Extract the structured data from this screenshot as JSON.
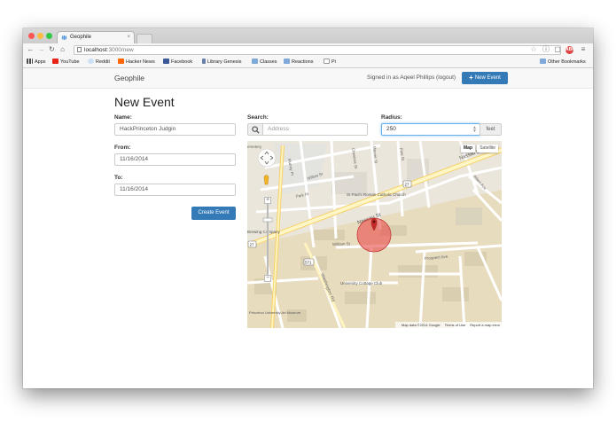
{
  "browser": {
    "tab_title": "Geophile",
    "tab_close": "×",
    "url_host": "localhost",
    "url_path": ":3000/new",
    "bookmarks": [
      "Apps",
      "YouTube",
      "Reddit",
      "Hacker News",
      "Facebook",
      "Library Genesis",
      "Classes",
      "Reactions",
      "Pi"
    ],
    "other_bookmarks": "Other Bookmarks",
    "abp_label": "ABP"
  },
  "nav": {
    "brand": "Geophile",
    "signed_in": "Signed in as Aqeel Phillips (logout)",
    "new_event_plus": "+",
    "new_event_label": "New Event"
  },
  "form": {
    "heading": "New Event",
    "name_label": "Name:",
    "name_value": "HackPrinceton Judgin",
    "from_label": "From:",
    "from_value": "11/16/2014",
    "to_label": "To:",
    "to_value": "11/16/2014",
    "create_label": "Create Event",
    "search_label": "Search:",
    "search_placeholder": "Address",
    "radius_label": "Radius:",
    "radius_value": "250",
    "radius_unit": "feet"
  },
  "map": {
    "type_map": "Map",
    "type_satellite": "Satellite",
    "footer_data": "Map data ©2014 Google",
    "footer_terms": "Terms of Use",
    "footer_report": "Report a map error",
    "streets": {
      "nassau": "Nassau St",
      "nassau2": "Nassau St",
      "william": "William St",
      "washington": "Washington Rd",
      "prospect": "Prospect Ave",
      "willow": "Willow St",
      "park": "Park Pl",
      "murray": "Murray Pl",
      "chestnut": "Chestnut St",
      "aiken": "Aiken Ave",
      "mercer": "Mercer St",
      "pine": "Pine St"
    },
    "places": {
      "church": "St Paul's Roman Catholic Church",
      "club": "University Cottage Club",
      "museum": "Princeton University Art Museum",
      "cemetery": "emetery",
      "brewing": "Brewing Company"
    },
    "route_27": "27",
    "route_571": "571",
    "zoom_in": "+",
    "zoom_out": "−",
    "circle_color": "#e84a4a"
  }
}
